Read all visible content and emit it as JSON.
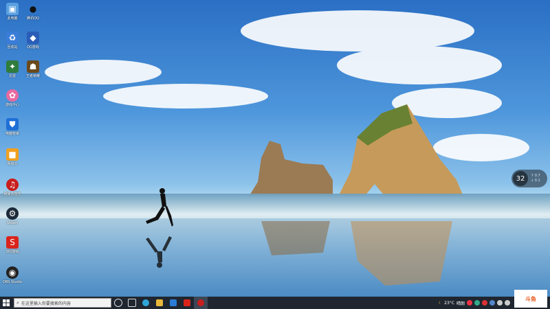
{
  "desktop_icons": [
    {
      "label": "此电脑",
      "icon": "computer-icon",
      "color": "#5aa0e0"
    },
    {
      "label": "腾讯QQ",
      "icon": "qq-penguin-icon",
      "color": "#111111"
    },
    {
      "label": "回收站",
      "icon": "recycle-bin-icon",
      "color": "#3a7dd8"
    },
    {
      "label": "QQ游戏",
      "icon": "game-icon",
      "color": "#2b5db8"
    },
    {
      "label": "迅雷",
      "icon": "thunder-icon",
      "color": "#2f7c3c"
    },
    {
      "label": "王者荣耀",
      "icon": "game-character-icon",
      "color": "#6a4a1b"
    },
    {
      "label": "游戏中心",
      "icon": "colorful-app-icon",
      "color": "#e86aa0"
    },
    {
      "label": "电脑管家",
      "icon": "shield-icon",
      "color": "#1f6fd6"
    },
    {
      "label": "网易云",
      "icon": "box-icon",
      "color": "#f0a020"
    },
    {
      "label": "网易云音乐",
      "icon": "music-icon",
      "color": "#c81e1e"
    },
    {
      "label": "Steam",
      "icon": "steam-icon",
      "color": "#1d2a3a"
    },
    {
      "label": "360游戏",
      "icon": "red-logo-icon",
      "color": "#d9241b"
    },
    {
      "label": "OBS Studio",
      "icon": "obs-icon",
      "color": "#222222"
    }
  ],
  "weather_widget": {
    "value": "32",
    "line1": "↑ 0.7",
    "line2": "↓ 0.1"
  },
  "taskbar": {
    "search_placeholder": "在这里输入你要搜索的内容",
    "apps": [
      "task-view-icon",
      "widgets-icon",
      "edge-icon",
      "file-explorer-icon",
      "store-icon",
      "red-app-icon",
      "netease-music-icon"
    ],
    "tray": {
      "temperature": "23°C",
      "weather": "晴朗"
    }
  },
  "watermark": {
    "text": "斗鱼"
  }
}
